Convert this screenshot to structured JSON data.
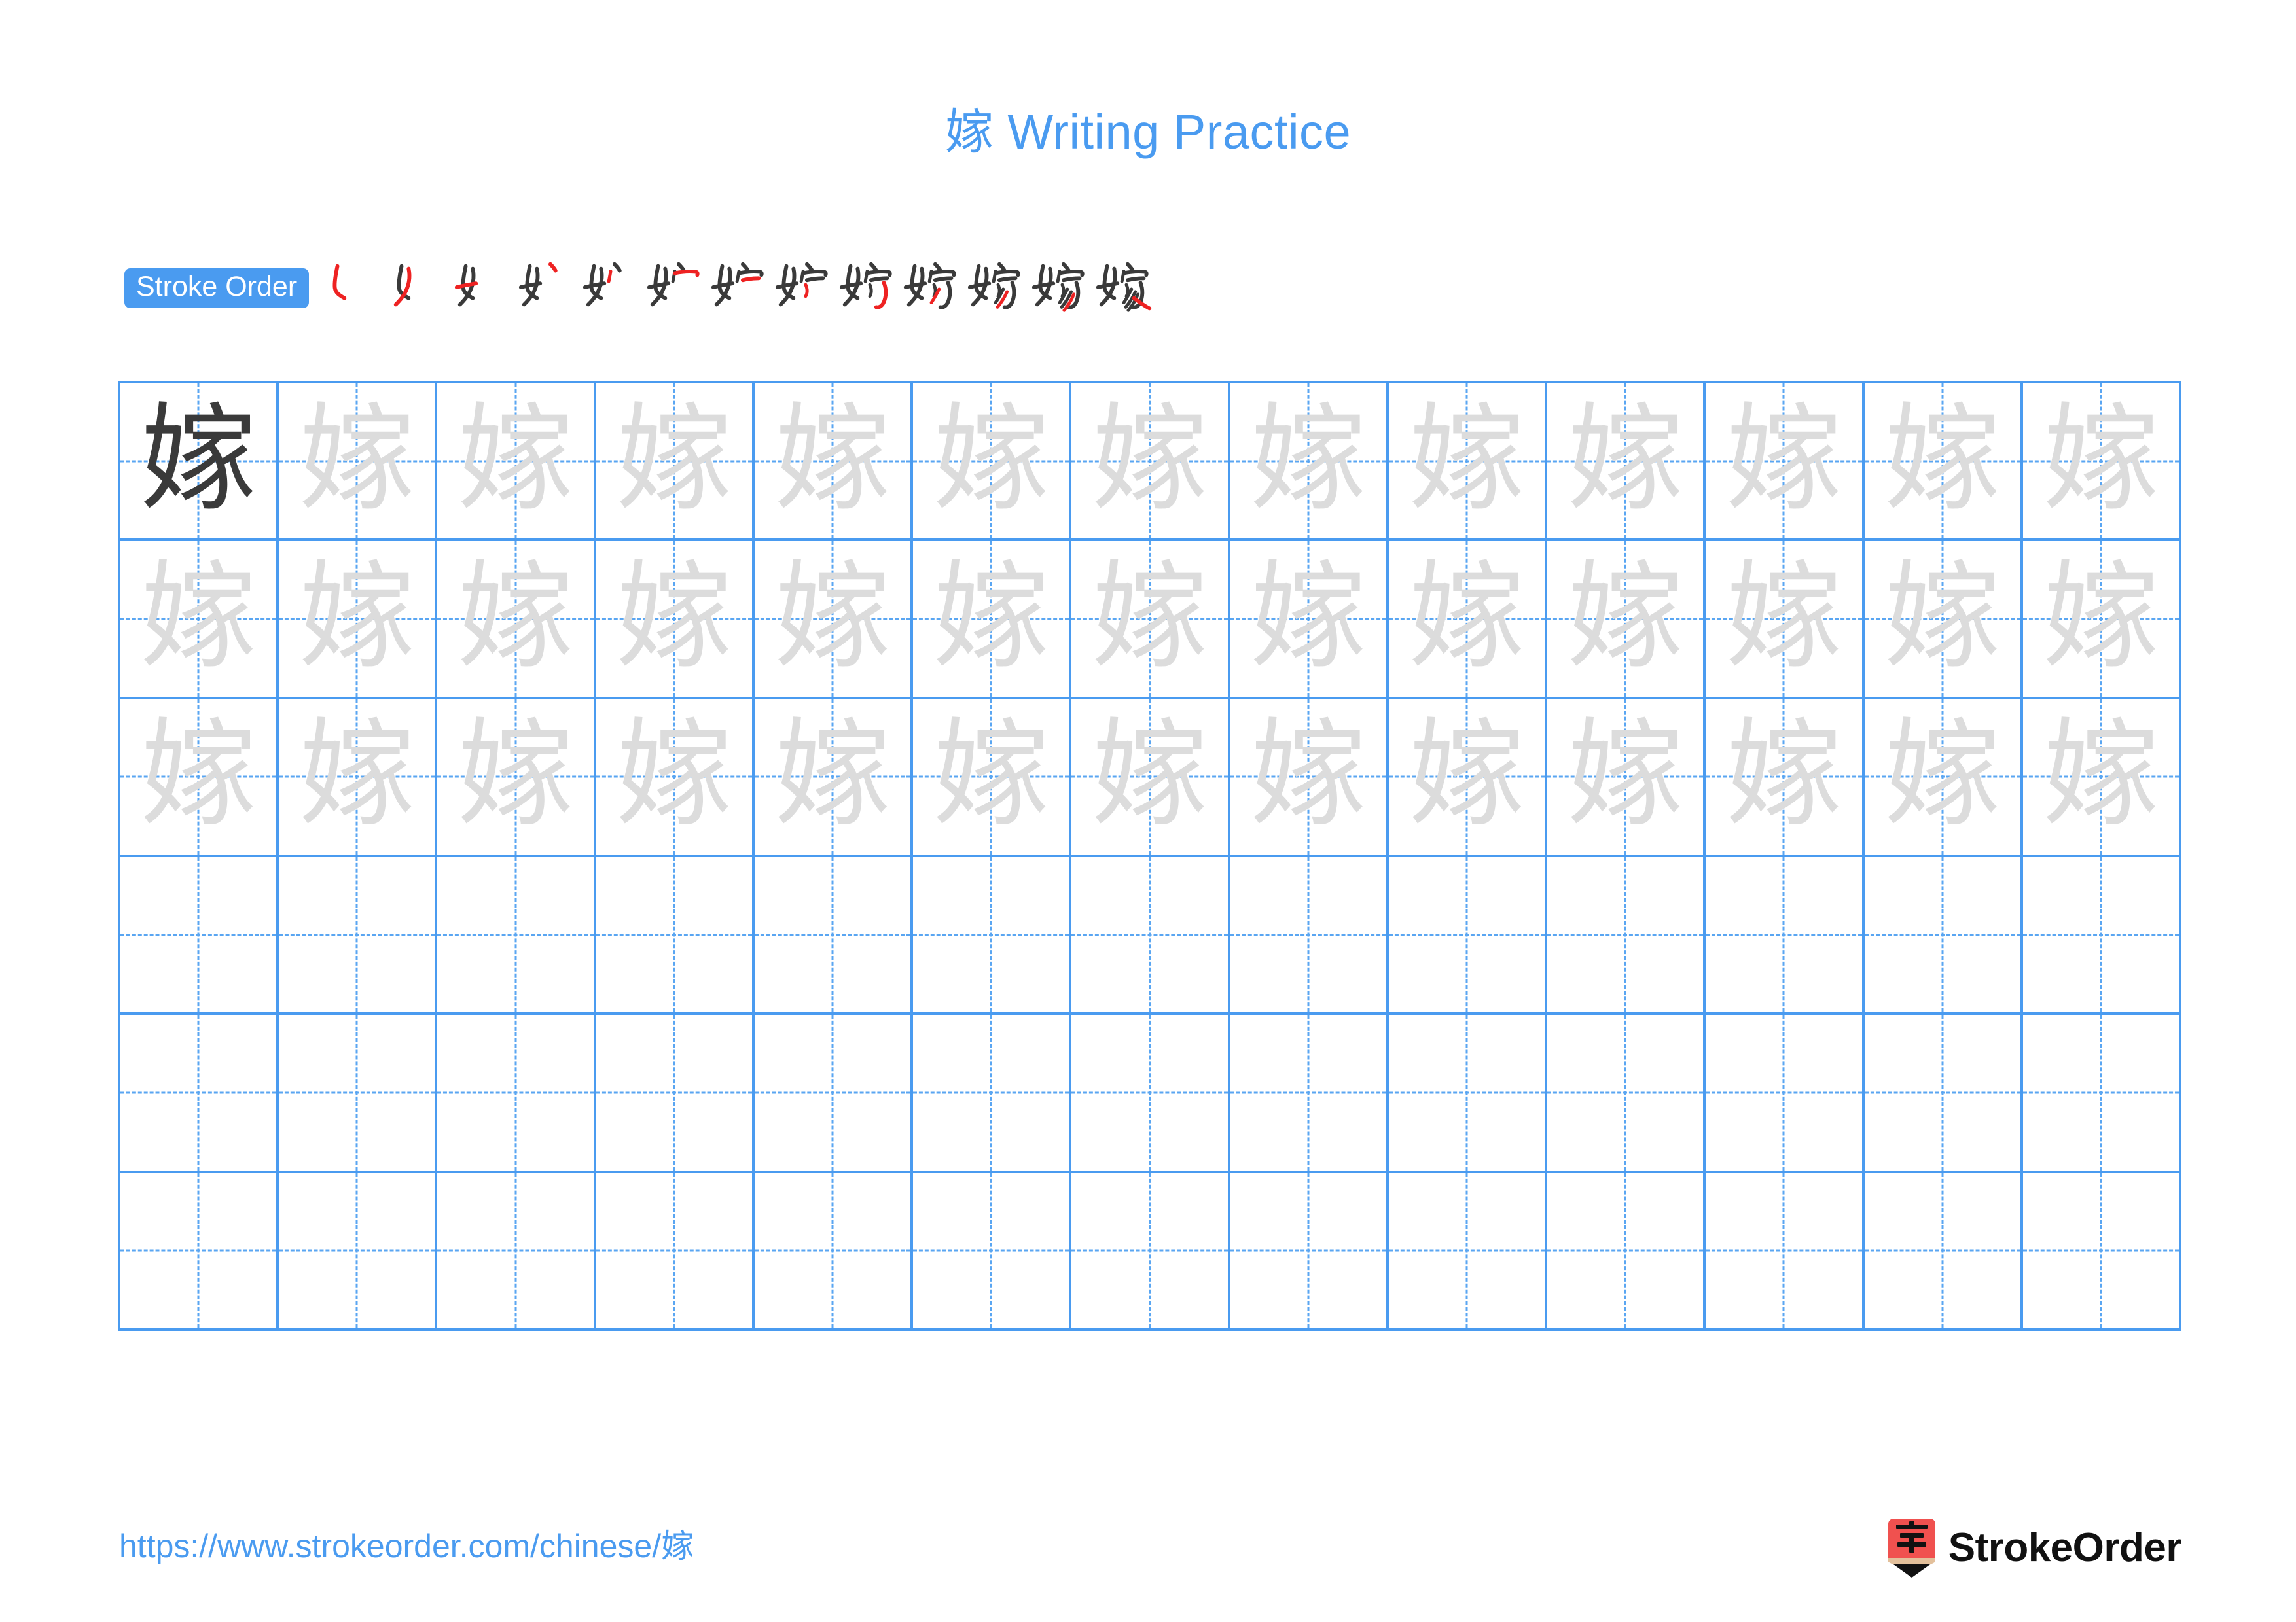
{
  "document": {
    "character": "嫁",
    "title": "嫁 Writing Practice",
    "title_character": "嫁",
    "title_text": " Writing Practice"
  },
  "stroke_order": {
    "label": "Stroke Order",
    "total_strokes": 13,
    "new_stroke_color": "#EE2222",
    "prior_stroke_color": "#3A3A3A",
    "steps": [
      {
        "index": 1,
        "character": "嫁",
        "strokes_drawn": 1
      },
      {
        "index": 2,
        "character": "嫁",
        "strokes_drawn": 2
      },
      {
        "index": 3,
        "character": "嫁",
        "strokes_drawn": 3
      },
      {
        "index": 4,
        "character": "嫁",
        "strokes_drawn": 4
      },
      {
        "index": 5,
        "character": "嫁",
        "strokes_drawn": 5
      },
      {
        "index": 6,
        "character": "嫁",
        "strokes_drawn": 6
      },
      {
        "index": 7,
        "character": "嫁",
        "strokes_drawn": 7
      },
      {
        "index": 8,
        "character": "嫁",
        "strokes_drawn": 8
      },
      {
        "index": 9,
        "character": "嫁",
        "strokes_drawn": 9
      },
      {
        "index": 10,
        "character": "嫁",
        "strokes_drawn": 10
      },
      {
        "index": 11,
        "character": "嫁",
        "strokes_drawn": 11
      },
      {
        "index": 12,
        "character": "嫁",
        "strokes_drawn": 12
      },
      {
        "index": 13,
        "character": "嫁",
        "strokes_drawn": 13
      }
    ]
  },
  "practice_grid": {
    "columns": 13,
    "rows": 6,
    "grid_line_color": "#4A9BF0",
    "guide_line_color": "#5AA6F2",
    "model_glyph_color": "#3A3A3A",
    "trace_glyph_color": "#DCDCDC",
    "cells": [
      [
        "model",
        "trace",
        "trace",
        "trace",
        "trace",
        "trace",
        "trace",
        "trace",
        "trace",
        "trace",
        "trace",
        "trace",
        "trace"
      ],
      [
        "trace",
        "trace",
        "trace",
        "trace",
        "trace",
        "trace",
        "trace",
        "trace",
        "trace",
        "trace",
        "trace",
        "trace",
        "trace"
      ],
      [
        "trace",
        "trace",
        "trace",
        "trace",
        "trace",
        "trace",
        "trace",
        "trace",
        "trace",
        "trace",
        "trace",
        "trace",
        "trace"
      ],
      [
        "empty",
        "empty",
        "empty",
        "empty",
        "empty",
        "empty",
        "empty",
        "empty",
        "empty",
        "empty",
        "empty",
        "empty",
        "empty"
      ],
      [
        "empty",
        "empty",
        "empty",
        "empty",
        "empty",
        "empty",
        "empty",
        "empty",
        "empty",
        "empty",
        "empty",
        "empty",
        "empty"
      ],
      [
        "empty",
        "empty",
        "empty",
        "empty",
        "empty",
        "empty",
        "empty",
        "empty",
        "empty",
        "empty",
        "empty",
        "empty",
        "empty"
      ]
    ]
  },
  "footer": {
    "url": "https://www.strokeorder.com/chinese/嫁",
    "brand_name": "StrokeOrder",
    "logo": {
      "icon_character": "字",
      "body_color": "#F0514F",
      "wood_color": "#E3C09B",
      "tip_color": "#111111"
    }
  },
  "colors": {
    "accent_blue": "#4A9BF0",
    "logo_red": "#F0514F",
    "stroke_red": "#EE2222",
    "ink_dark": "#3A3A3A",
    "trace_gray": "#DCDCDC",
    "background": "#FFFFFF"
  }
}
